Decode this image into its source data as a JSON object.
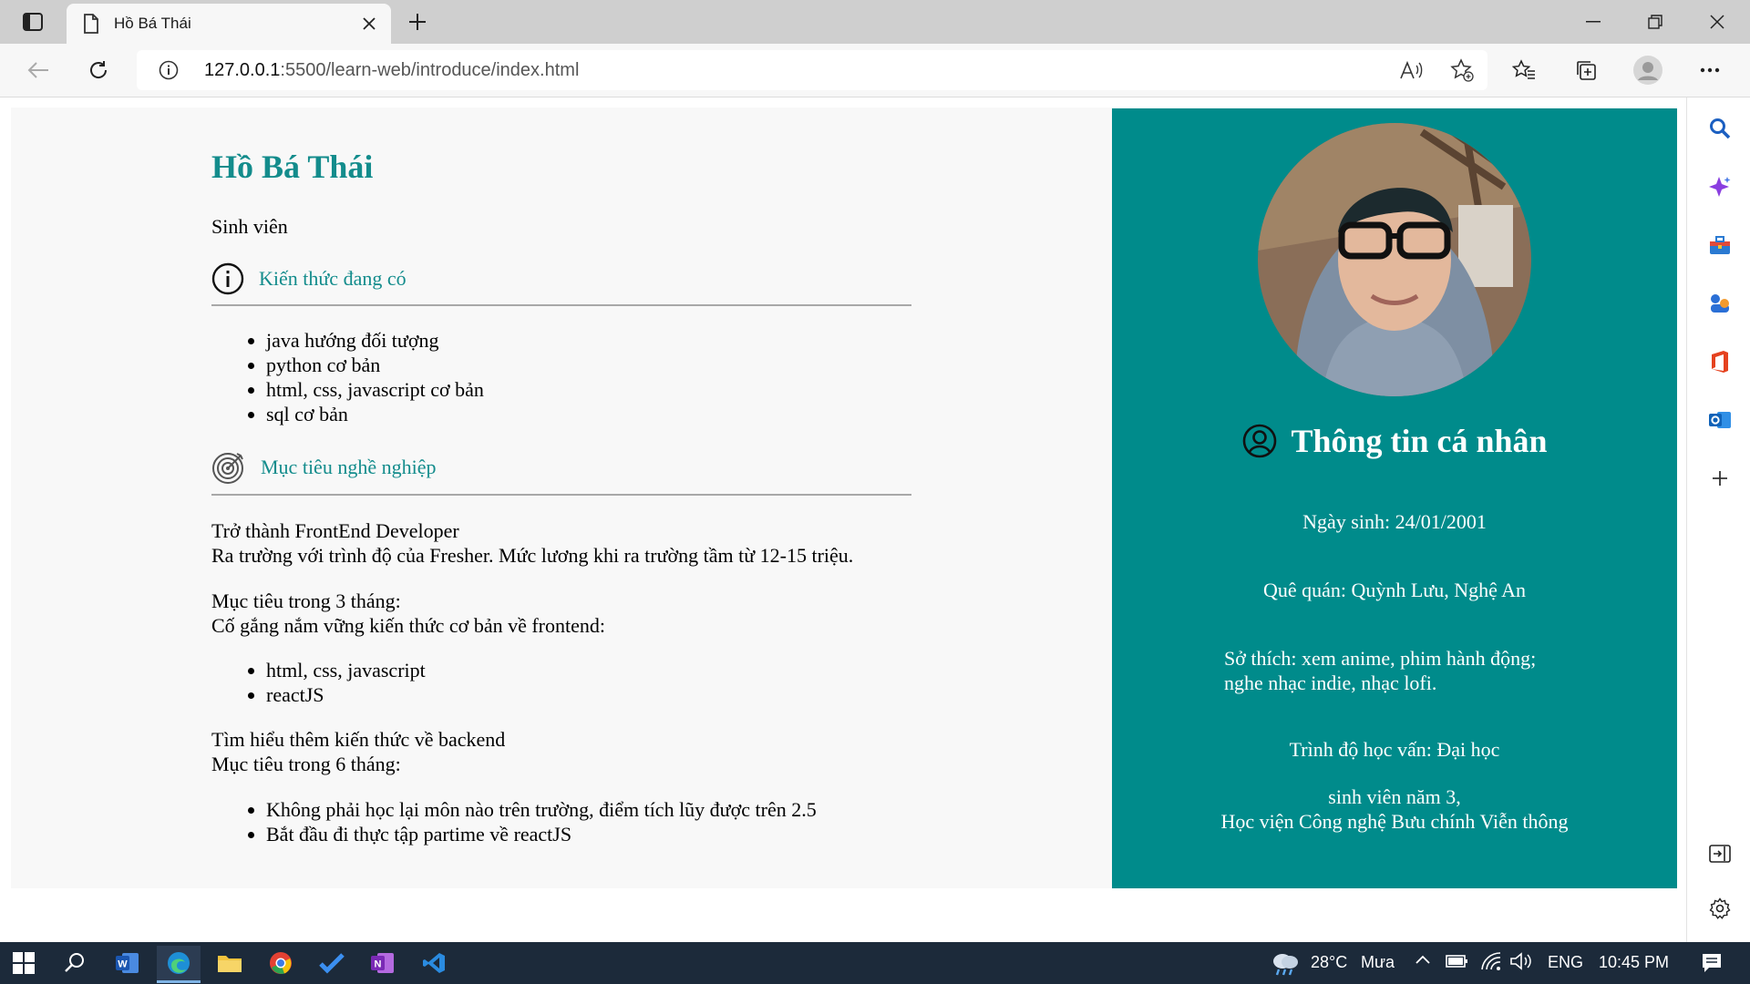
{
  "browser": {
    "tab_title": "Hồ Bá Thái",
    "url_host": "127.0.0.1",
    "url_path": ":5500/learn-web/introduce/index.html"
  },
  "page": {
    "name": "Hồ Bá Thái",
    "role": "Sinh viên",
    "skills_heading": "Kiến thức đang có",
    "skills": [
      "java hướng đối tượng",
      "python cơ bản",
      "html, css, javascript cơ bản",
      "sql cơ bản"
    ],
    "goals_heading": "Mục tiêu nghề nghiệp",
    "goal_line1": "Trở thành FrontEnd Developer",
    "goal_line2": "Ra trường với trình độ của Fresher. Mức lương khi ra trường tầm từ 12-15 triệu.",
    "goal_3m_title": "Mục tiêu trong 3 tháng:",
    "goal_3m_desc": "Cố gắng nắm vững kiến thức cơ bản về frontend:",
    "goal_3m_items": [
      "html, css, javascript",
      "reactJS"
    ],
    "goal_backend": "Tìm hiểu thêm kiến thức về backend",
    "goal_6m_title": "Mục tiêu trong 6 tháng:",
    "goal_6m_items": [
      "Không phải học lại môn nào trên trường, điểm tích lũy được trên 2.5",
      "Bắt đầu đi thực tập partime về reactJS"
    ]
  },
  "card": {
    "title": "Thông tin cá nhân",
    "birthday": "Ngày sinh: 24/01/2001",
    "hometown": "Quê quán: Quỳnh Lưu, Nghệ An",
    "hobby_line1": "Sở thích: xem anime, phim hành động;",
    "hobby_line2": "nghe nhạc indie, nhạc lofi.",
    "education": "Trình độ học vấn: Đại học",
    "school_line1": "sinh viên năm 3,",
    "school_line2": "Học viện Công nghệ Bưu chính Viễn thông"
  },
  "taskbar": {
    "weather_temp": "28°C",
    "weather_desc": "Mưa",
    "language": "ENG",
    "time": "10:45 PM"
  },
  "colors": {
    "accent": "#138c8c",
    "card_bg": "#008b8b",
    "taskbar_bg": "#1c2a3a"
  }
}
